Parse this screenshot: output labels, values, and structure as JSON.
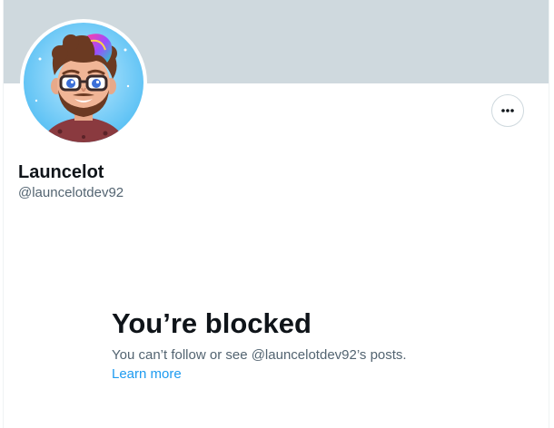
{
  "profile": {
    "display_name": "Launcelot",
    "handle": "@launcelotdev92",
    "avatar_icon": "cartoon-avatar-portrait",
    "banner_color": "#cfd9de"
  },
  "actions": {
    "more_icon": "more-horizontal-icon"
  },
  "blocked": {
    "title": "You’re blocked",
    "description": "You can’t follow or see @launcelotdev92’s posts.",
    "learn_more": "Learn more"
  },
  "colors": {
    "text_primary": "#0f1419",
    "text_secondary": "#536471",
    "link": "#1d9bf0"
  }
}
